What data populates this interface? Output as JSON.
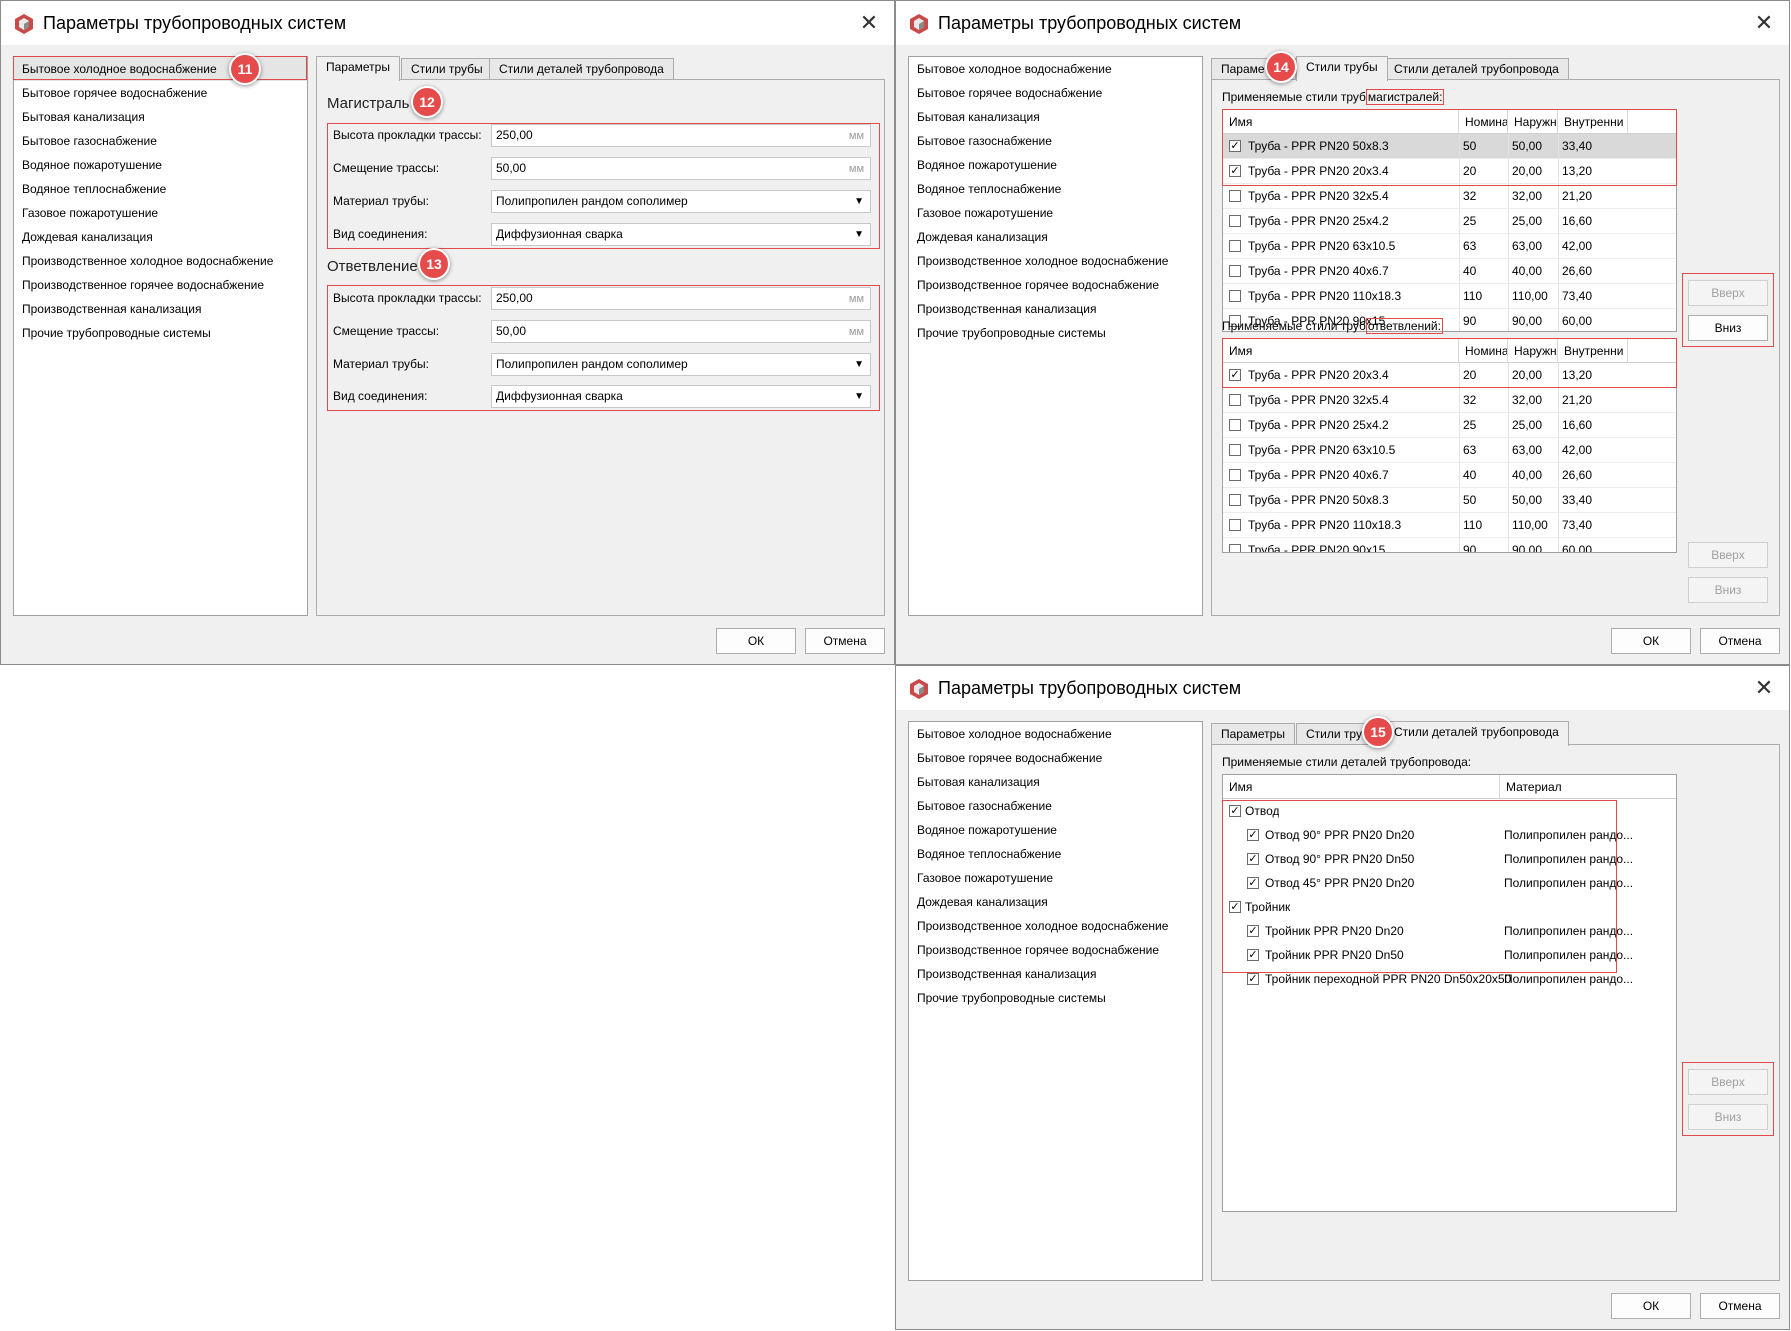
{
  "window": {
    "title": "Параметры трубопроводных систем"
  },
  "systems": [
    "Бытовое холодное водоснабжение",
    "Бытовое горячее водоснабжение",
    "Бытовая канализация",
    "Бытовое газоснабжение",
    "Водяное пожаротушение",
    "Водяное теплоснабжение",
    "Газовое пожаротушение",
    "Дождевая канализация",
    "Производственное холодное водоснабжение",
    "Производственное горячее водоснабжение",
    "Производственная канализация",
    "Прочие трубопроводные системы"
  ],
  "tabs": {
    "params": "Параметры",
    "pipe_styles": "Стили трубы",
    "detail_styles": "Стили деталей трубопровода",
    "params_partial": "Параме",
    "pipe_styles_partial": "Стили труб"
  },
  "buttons": {
    "ok": "ОК",
    "cancel": "Отмена",
    "up": "Вверх",
    "down": "Вниз"
  },
  "badges": {
    "b11": "11",
    "b12": "12",
    "b13": "13",
    "b14": "14",
    "b15": "15"
  },
  "params": {
    "main": {
      "title": "Магистраль",
      "height_label": "Высота прокладки трассы:",
      "height_value": "250,00",
      "offset_label": "Смещение трассы:",
      "offset_value": "50,00",
      "material_label": "Материал трубы:",
      "material_value": "Полипропилен рандом сополимер",
      "joint_label": "Вид соединения:",
      "joint_value": "Диффузионная сварка",
      "unit": "мм"
    },
    "branch": {
      "title": "Ответвление",
      "height_label": "Высота прокладки трассы:",
      "height_value": "250,00",
      "offset_label": "Смещение трассы:",
      "offset_value": "50,00",
      "material_label": "Материал трубы:",
      "material_value": "Полипропилен рандом сополимер",
      "joint_label": "Вид соединения:",
      "joint_value": "Диффузионная сварка",
      "unit": "мм"
    }
  },
  "pipe_styles": {
    "main_caption_prefix": "Применяемые стили труб",
    "main_caption_highlight": "магистралей:",
    "branch_caption_prefix": "Применяемые стили труб",
    "branch_caption_highlight": "ответвлений:",
    "columns": [
      "Имя",
      "Номина.",
      "Наружн",
      "Внутренни"
    ],
    "main_rows": [
      {
        "checked": true,
        "name": "Труба - PPR PN20 50x8.3",
        "nominal": "50",
        "outer": "50,00",
        "inner": "33,40"
      },
      {
        "checked": true,
        "name": "Труба - PPR PN20 20x3.4",
        "nominal": "20",
        "outer": "20,00",
        "inner": "13,20"
      },
      {
        "checked": false,
        "name": "Труба - PPR PN20 32x5.4",
        "nominal": "32",
        "outer": "32,00",
        "inner": "21,20"
      },
      {
        "checked": false,
        "name": "Труба - PPR PN20 25x4.2",
        "nominal": "25",
        "outer": "25,00",
        "inner": "16,60"
      },
      {
        "checked": false,
        "name": "Труба - PPR PN20 63x10.5",
        "nominal": "63",
        "outer": "63,00",
        "inner": "42,00"
      },
      {
        "checked": false,
        "name": "Труба - PPR PN20 40x6.7",
        "nominal": "40",
        "outer": "40,00",
        "inner": "26,60"
      },
      {
        "checked": false,
        "name": "Труба - PPR PN20 110x18.3",
        "nominal": "110",
        "outer": "110,00",
        "inner": "73,40"
      },
      {
        "checked": false,
        "name": "Труба - PPR PN20 90x15",
        "nominal": "90",
        "outer": "90,00",
        "inner": "60,00"
      }
    ],
    "branch_rows": [
      {
        "checked": true,
        "name": "Труба - PPR PN20 20x3.4",
        "nominal": "20",
        "outer": "20,00",
        "inner": "13,20"
      },
      {
        "checked": false,
        "name": "Труба - PPR PN20 32x5.4",
        "nominal": "32",
        "outer": "32,00",
        "inner": "21,20"
      },
      {
        "checked": false,
        "name": "Труба - PPR PN20 25x4.2",
        "nominal": "25",
        "outer": "25,00",
        "inner": "16,60"
      },
      {
        "checked": false,
        "name": "Труба - PPR PN20 63x10.5",
        "nominal": "63",
        "outer": "63,00",
        "inner": "42,00"
      },
      {
        "checked": false,
        "name": "Труба - PPR PN20 40x6.7",
        "nominal": "40",
        "outer": "40,00",
        "inner": "26,60"
      },
      {
        "checked": false,
        "name": "Труба - PPR PN20 50x8.3",
        "nominal": "50",
        "outer": "50,00",
        "inner": "33,40"
      },
      {
        "checked": false,
        "name": "Труба - PPR PN20 110x18.3",
        "nominal": "110",
        "outer": "110,00",
        "inner": "73,40"
      },
      {
        "checked": false,
        "name": "Труба - PPR PN20 90x15",
        "nominal": "90",
        "outer": "90,00",
        "inner": "60,00"
      }
    ]
  },
  "detail_styles": {
    "caption": "Применяемые стили деталей трубопровода:",
    "columns": [
      "Имя",
      "Материал"
    ],
    "groups": [
      {
        "name": "Отвод",
        "checked": true,
        "items": [
          {
            "name": "Отвод 90° PPR PN20 Dn20",
            "material": "Полипропилен рандо...",
            "checked": true
          },
          {
            "name": "Отвод 90° PPR PN20 Dn50",
            "material": "Полипропилен рандо...",
            "checked": true
          },
          {
            "name": "Отвод 45° PPR PN20 Dn20",
            "material": "Полипропилен рандо...",
            "checked": true
          }
        ]
      },
      {
        "name": "Тройник",
        "checked": true,
        "items": [
          {
            "name": "Тройник PPR PN20 Dn20",
            "material": "Полипропилен рандо...",
            "checked": true
          },
          {
            "name": "Тройник PPR PN20 Dn50",
            "material": "Полипропилен рандо...",
            "checked": true
          },
          {
            "name": "Тройник переходной PPR PN20 Dn50x20x50",
            "material": "Полипропилен рандо...",
            "checked": true
          }
        ]
      }
    ]
  },
  "colors": {
    "highlight": "#e04a4a",
    "badge": "#e54b4b",
    "selection": "#e5e5e5"
  }
}
